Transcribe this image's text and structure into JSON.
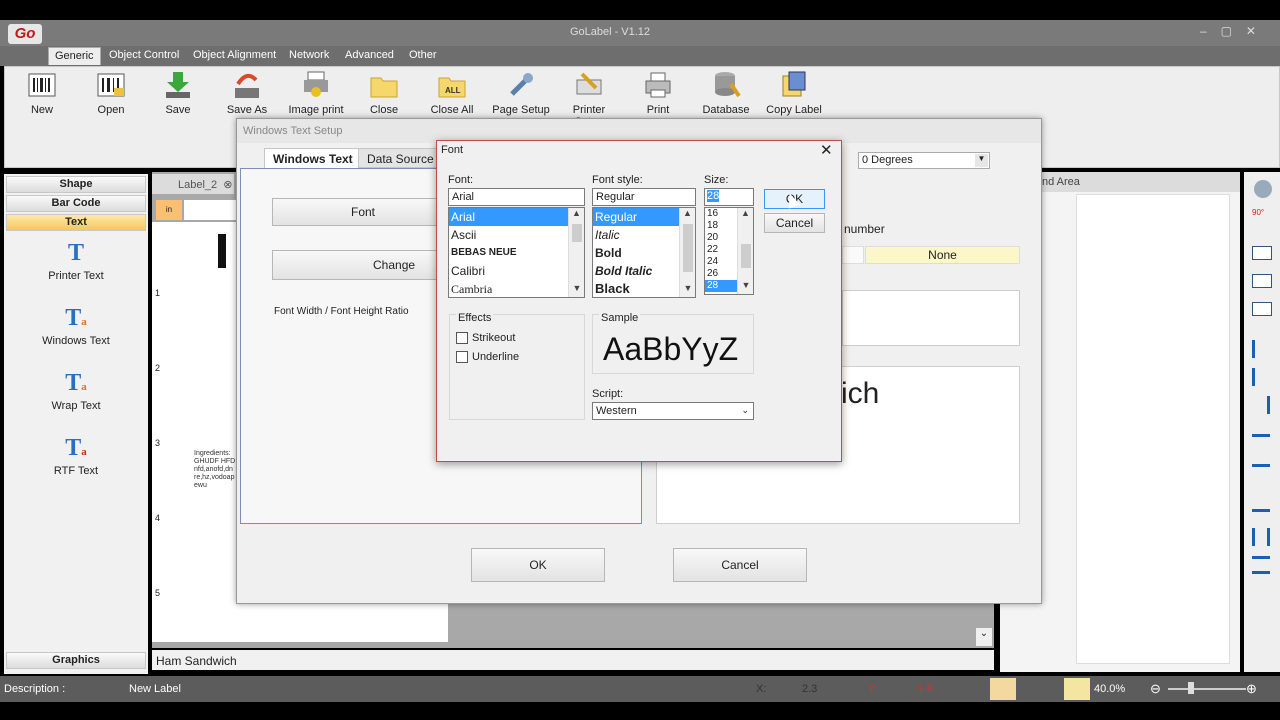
{
  "app": {
    "title": "GoLabel - V1.12",
    "logo": "Go"
  },
  "menu_tabs": [
    "Generic",
    "Object Control",
    "Object Alignment",
    "Network",
    "Advanced",
    "Other"
  ],
  "ribbon": [
    {
      "label": "New",
      "icon": "barcode-icon"
    },
    {
      "label": "Open",
      "icon": "barcode-open-icon"
    },
    {
      "label": "Save",
      "icon": "save-arrow-icon"
    },
    {
      "label": "Save As",
      "icon": "save-as-icon"
    },
    {
      "label": "Image print",
      "icon": "image-print-icon"
    },
    {
      "label": "Close",
      "icon": "folder-icon"
    },
    {
      "label": "Close All",
      "icon": "folder-all-icon"
    },
    {
      "label": "Page Setup",
      "icon": "wrench-icon"
    },
    {
      "label": "Printer Setup",
      "icon": "printer-setup-icon"
    },
    {
      "label": "Print",
      "icon": "printer-icon"
    },
    {
      "label": "Database",
      "icon": "database-icon"
    },
    {
      "label": "Copy Label",
      "icon": "copy-label-icon"
    }
  ],
  "left_panel": {
    "headers": [
      "Shape",
      "Bar Code",
      "Text"
    ],
    "items": [
      "Printer Text",
      "Windows Text",
      "Wrap Text",
      "RTF Text"
    ],
    "footer": "Graphics"
  },
  "canvas": {
    "tab_label": "Label_2",
    "ruler_numbers": [
      "1",
      "2",
      "3",
      "4",
      "5"
    ],
    "corner": "in",
    "ingredients": [
      "Ingredients:",
      "GHUDF HFD",
      "nfd,anofd,dn",
      "re,hz,vodoap",
      "ewu"
    ],
    "description_text": "Ham Sandwich"
  },
  "right_panel": {
    "title": "nd Area"
  },
  "status": {
    "description_label": "Description :",
    "description_value": "New Label",
    "x_label": "X:",
    "x_value": "2.3",
    "y_label": "Y:",
    "y_value": "-1.8",
    "zoom": "40.0%"
  },
  "wts": {
    "title": "Windows Text Setup",
    "tabs": [
      "Windows Text",
      "Data Source"
    ],
    "font_button": "Font",
    "change_button": "Change",
    "ratio_label": "Font Width / Font Height Ratio",
    "rotation_value": "0 Degrees",
    "number_label": "number",
    "none_value": "None",
    "preview_text": "ich",
    "ok": "OK",
    "cancel": "Cancel"
  },
  "font_dialog": {
    "title": "Font",
    "font_label": "Font:",
    "font_value": "Arial",
    "fonts": [
      "Arial",
      "Ascii",
      "BEBAS NEUE",
      "Calibri",
      "Cambria"
    ],
    "style_label": "Font style:",
    "style_value": "Regular",
    "styles": [
      "Regular",
      "Italic",
      "Bold",
      "Bold Italic",
      "Black"
    ],
    "size_label": "Size:",
    "size_value": "28",
    "sizes": [
      "16",
      "18",
      "20",
      "22",
      "24",
      "26",
      "28"
    ],
    "ok": "OK",
    "cancel": "Cancel",
    "effects_label": "Effects",
    "strikeout": "Strikeout",
    "underline": "Underline",
    "sample_label": "Sample",
    "sample_text": "AaBbYyZ",
    "script_label": "Script:",
    "script_value": "Western"
  }
}
